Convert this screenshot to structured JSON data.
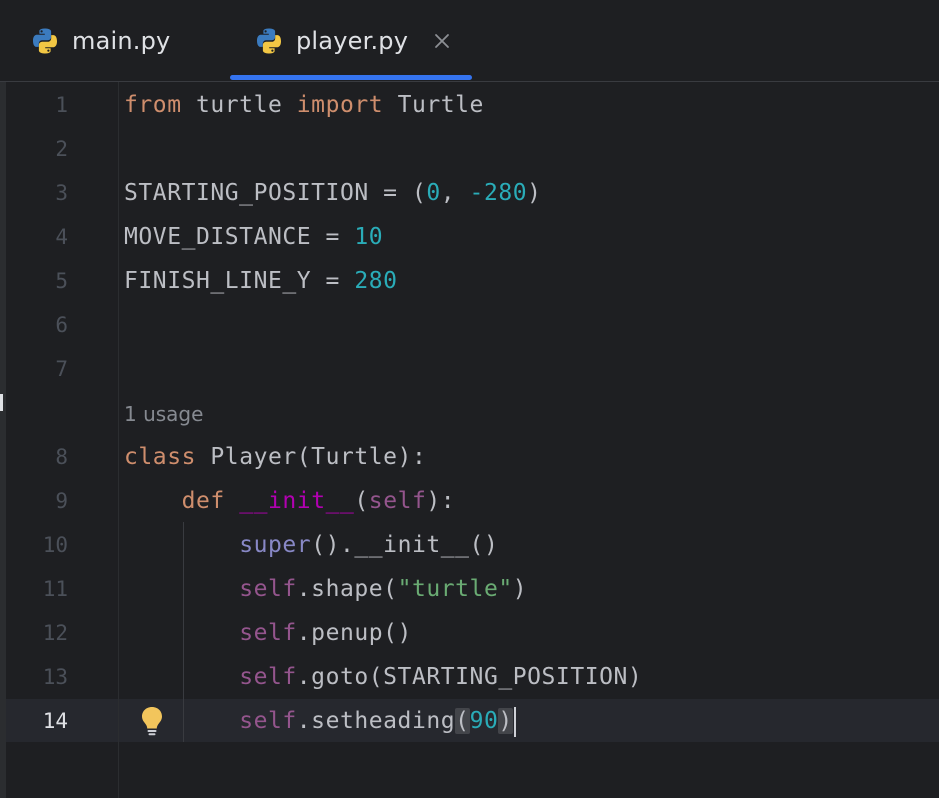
{
  "tabs": [
    {
      "label": "main.py",
      "icon": "python-icon",
      "active": false
    },
    {
      "label": "player.py",
      "icon": "python-icon",
      "active": true,
      "close_icon": "close-icon"
    }
  ],
  "colors": {
    "background": "#1e1f22",
    "accent": "#3574f0",
    "keyword": "#cf8e6d",
    "number": "#2aacb8",
    "self": "#94558d",
    "magic": "#b200b2",
    "builtin": "#8888c6",
    "string": "#6aab73",
    "text": "#bcbec4",
    "line_number": "#4b5059"
  },
  "inlay_hint": "1 usage",
  "lightbulb_icon": "lightbulb-icon",
  "lines": [
    {
      "n": "1",
      "tokens": [
        {
          "t": "from",
          "c": "kw"
        },
        {
          "t": " turtle "
        },
        {
          "t": "import",
          "c": "kw"
        },
        {
          "t": " Turtle"
        }
      ]
    },
    {
      "n": "2",
      "tokens": []
    },
    {
      "n": "3",
      "tokens": [
        {
          "t": "STARTING_POSITION = ("
        },
        {
          "t": "0",
          "c": "num"
        },
        {
          "t": ", "
        },
        {
          "t": "-280",
          "c": "num"
        },
        {
          "t": ")"
        }
      ]
    },
    {
      "n": "4",
      "tokens": [
        {
          "t": "MOVE_DISTANCE = "
        },
        {
          "t": "10",
          "c": "num"
        }
      ]
    },
    {
      "n": "5",
      "tokens": [
        {
          "t": "FINISH_LINE_Y = "
        },
        {
          "t": "280",
          "c": "num"
        }
      ]
    },
    {
      "n": "6",
      "tokens": []
    },
    {
      "n": "7",
      "tokens": []
    },
    {
      "n": "8",
      "tokens": [
        {
          "t": "class",
          "c": "kw"
        },
        {
          "t": " Player(Turtle):"
        }
      ]
    },
    {
      "n": "9",
      "tokens": [
        {
          "t": "    "
        },
        {
          "t": "def",
          "c": "kw"
        },
        {
          "t": " "
        },
        {
          "t": "__init__",
          "c": "magic"
        },
        {
          "t": "("
        },
        {
          "t": "self",
          "c": "self"
        },
        {
          "t": "):"
        }
      ]
    },
    {
      "n": "10",
      "tokens": [
        {
          "t": "        "
        },
        {
          "t": "super",
          "c": "builtin"
        },
        {
          "t": "().__init__()"
        }
      ]
    },
    {
      "n": "11",
      "tokens": [
        {
          "t": "        "
        },
        {
          "t": "self",
          "c": "self"
        },
        {
          "t": ".shape("
        },
        {
          "t": "\"turtle\"",
          "c": "str"
        },
        {
          "t": ")"
        }
      ]
    },
    {
      "n": "12",
      "tokens": [
        {
          "t": "        "
        },
        {
          "t": "self",
          "c": "self"
        },
        {
          "t": ".penup()"
        }
      ]
    },
    {
      "n": "13",
      "tokens": [
        {
          "t": "        "
        },
        {
          "t": "self",
          "c": "self"
        },
        {
          "t": ".goto(STARTING_POSITION)"
        }
      ]
    },
    {
      "n": "14",
      "active": true,
      "tokens": [
        {
          "t": "        "
        },
        {
          "t": "self",
          "c": "self"
        },
        {
          "t": ".setheading"
        },
        {
          "t": "(",
          "c": "paren-match"
        },
        {
          "t": "90",
          "c": "num"
        },
        {
          "t": ")",
          "c": "paren-match"
        }
      ]
    }
  ]
}
